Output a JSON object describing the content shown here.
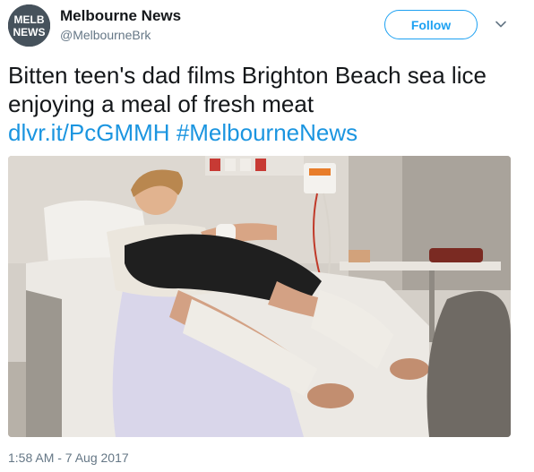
{
  "account": {
    "display_name": "Melbourne News",
    "handle": "@MelbourneBrk",
    "avatar_text_top": "MELB",
    "avatar_text_bottom": "NEWS"
  },
  "actions": {
    "follow_label": "Follow",
    "menu_icon": "chevron-down-icon"
  },
  "tweet": {
    "text_line1": "Bitten teen's dad films Brighton Beach sea lice",
    "text_line2": "enjoying a meal of fresh meat",
    "link": "dlvr.it/PcGMMH",
    "hashtag": "#MelbourneNews"
  },
  "footer": {
    "timestamp": "1:58 AM - 7 Aug 2017"
  },
  "colors": {
    "link_blue": "#1b95e0",
    "follow_blue": "#1da1f2",
    "secondary_text": "#657786"
  }
}
